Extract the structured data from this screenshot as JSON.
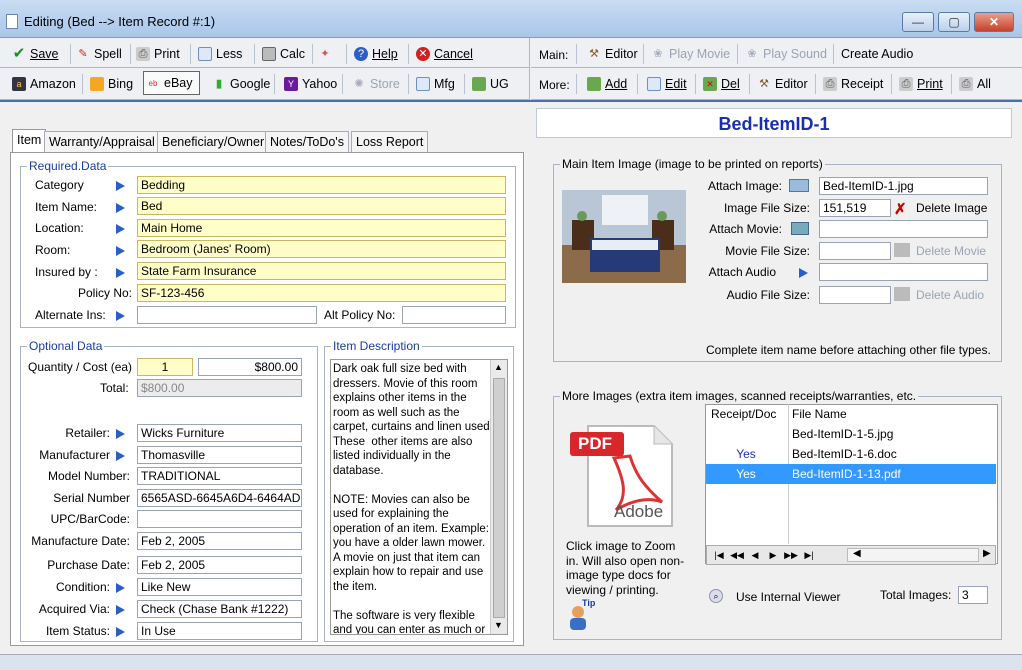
{
  "window": {
    "title": "Editing  (Bed --> Item Record #:1)",
    "min": "—",
    "max": "▢",
    "close": "✕"
  },
  "toolbar_left_1": [
    {
      "label": "Save",
      "icon": "checkmark-icon",
      "color": "#1a8f1a"
    },
    {
      "label": "Spell",
      "icon": "spellcheck-icon",
      "color": "#c03020"
    },
    {
      "label": "Print",
      "icon": "printer-icon",
      "color": "#777"
    },
    {
      "label": "Less",
      "icon": "page-icon",
      "color": "#4a7ac7"
    },
    {
      "label": "Calc",
      "icon": "calculator-icon",
      "color": "#666"
    },
    {
      "label": "",
      "icon": "tools-icon",
      "color": "#c88"
    },
    {
      "label": "Help",
      "icon": "help-icon",
      "color": "#2b5fc7"
    },
    {
      "label": "Cancel",
      "icon": "cancel-icon",
      "color": "#d02020"
    }
  ],
  "toolbar_left_2": [
    {
      "label": "Amazon",
      "icon": "amazon-icon"
    },
    {
      "label": "Bing",
      "icon": "bing-icon"
    },
    {
      "label": "eBay",
      "icon": "ebay-icon"
    },
    {
      "label": "Google",
      "icon": "google-icon"
    },
    {
      "label": "Yahoo",
      "icon": "yahoo-icon"
    },
    {
      "label": "Store",
      "icon": "store-icon",
      "disabled": true
    },
    {
      "label": "Mfg",
      "icon": "mfg-icon"
    },
    {
      "label": "UG",
      "icon": "ug-icon"
    }
  ],
  "toolbar_right_1": {
    "prefix": "Main:",
    "items": [
      {
        "label": "Editor",
        "icon": "editor-icon"
      },
      {
        "label": "Play Movie",
        "icon": "film-icon",
        "disabled": true
      },
      {
        "label": "Play Sound",
        "icon": "sound-icon",
        "disabled": true
      },
      {
        "label": "Create Audio",
        "icon": ""
      }
    ]
  },
  "toolbar_right_2": {
    "prefix": "More:",
    "items": [
      {
        "label": "Add",
        "icon": "add-icon"
      },
      {
        "label": "Edit",
        "icon": "edit-icon"
      },
      {
        "label": "Del",
        "icon": "delete-icon"
      },
      {
        "label": "Editor",
        "icon": "editor-icon"
      },
      {
        "label": "Receipt",
        "icon": "receipt-icon"
      },
      {
        "label": "Print",
        "icon": "printer-icon"
      },
      {
        "label": "All",
        "icon": "all-icon"
      }
    ]
  },
  "tabs": [
    "Item",
    "Warranty/Appraisal",
    "Beneficiary/Owner",
    "Notes/ToDo's",
    "Loss Report"
  ],
  "required": {
    "title": "Required.Data",
    "rows": [
      {
        "label": "Category",
        "value": "Bedding"
      },
      {
        "label": "Item Name:",
        "value": "Bed"
      },
      {
        "label": "Location:",
        "value": "Main Home"
      },
      {
        "label": "Room:",
        "value": "Bedroom (Janes' Room)"
      },
      {
        "label": "Insured by :",
        "value": "State Farm Insurance"
      }
    ],
    "policy_label": "Policy No:",
    "policy_value": "SF-123-456",
    "alt_ins_label": "Alternate Ins:",
    "alt_ins_value": "",
    "alt_policy_label": "Alt Policy No:",
    "alt_policy_value": ""
  },
  "optional": {
    "title": "Optional Data",
    "qty_label": "Quantity / Cost (ea)",
    "qty": "1",
    "cost": "$800.00",
    "total_label": "Total:",
    "total": "$800.00",
    "rows": [
      {
        "label": "Retailer:",
        "value": "Wicks Furniture",
        "arrow": true
      },
      {
        "label": "Manufacturer",
        "value": "Thomasville",
        "arrow": true
      },
      {
        "label": "Model Number:",
        "value": "TRADITIONAL",
        "arrow": false
      },
      {
        "label": "Serial Number",
        "value": "6565ASD-6645A6D4-6464AD",
        "arrow": false
      },
      {
        "label": "UPC/BarCode:",
        "value": "",
        "arrow": false
      },
      {
        "label": "Manufacture Date:",
        "value": "Feb 2, 2005",
        "arrow": false
      },
      {
        "label": "Purchase Date:",
        "value": "Feb 2, 2005",
        "arrow": false
      },
      {
        "label": "Condition:",
        "value": "Like New",
        "arrow": true
      },
      {
        "label": "Acquired Via:",
        "value": "Check (Chase Bank #1222)",
        "arrow": true
      },
      {
        "label": "Item Status:",
        "value": "In Use",
        "arrow": true
      }
    ]
  },
  "description": {
    "title": "Item Description",
    "text": "Dark oak full size bed with dressers. Movie of this room explains other items in the room as well such as the carpet, curtains and linen used. These  other items are also listed individually in the database.\n\nNOTE: Movies can also be used for explaining the operation of an item. Example: you have a older lawn mower. A movie on just that item can explain how to repair and use the item.\n\nThe software is very flexible and you can enter as much or"
  },
  "item_title": "Bed-ItemID-1",
  "main_image": {
    "title": "Main Item Image (image to be printed on reports)",
    "attach_image_label": "Attach Image:",
    "attach_image_value": "Bed-ItemID-1.jpg",
    "size_label": "Image File Size:",
    "size_value": "151,519",
    "delete_image": "Delete Image",
    "attach_movie_label": "Attach Movie:",
    "movie_size_label": "Movie File Size:",
    "delete_movie": "Delete Movie",
    "attach_audio_label": "Attach Audio",
    "audio_size_label": "Audio File Size:",
    "delete_audio": "Delete Audio",
    "note": "Complete item name before attaching other file types."
  },
  "more_images": {
    "title": "More Images (extra item images, scanned receipts/warranties, etc.",
    "col1": "Receipt/Doc",
    "col2": "File Name",
    "rows": [
      {
        "receipt": "",
        "file": "Bed-ItemID-1-5.jpg",
        "selected": false
      },
      {
        "receipt": "Yes",
        "file": "Bed-ItemID-1-6.doc",
        "selected": false
      },
      {
        "receipt": "Yes",
        "file": "Bed-ItemID-1-13.pdf",
        "selected": true
      }
    ],
    "pdf_label": "PDF",
    "adobe_label": "Adobe",
    "hint": "Click image to Zoom in. Will also open non-image type docs for viewing / printing.",
    "tip": "Tip",
    "internal_viewer": "Use Internal Viewer",
    "total_label": "Total Images:",
    "total_value": "3",
    "nav": [
      "|◀",
      "◀◀",
      "◀",
      "▶",
      "▶▶",
      "▶|"
    ]
  }
}
